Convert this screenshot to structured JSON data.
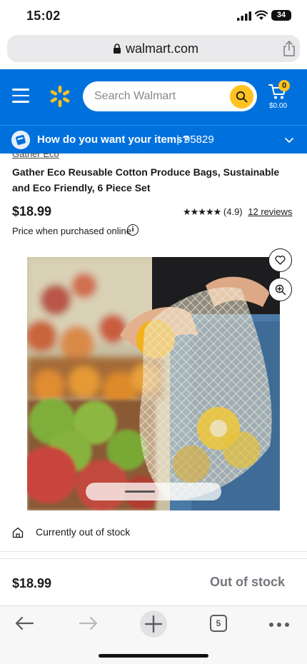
{
  "status_bar": {
    "time": "15:02",
    "battery": "34"
  },
  "browser": {
    "url": "walmart.com",
    "tabs_count": "5"
  },
  "header": {
    "search_placeholder": "Search Walmart",
    "cart_count": "0",
    "cart_total": "$0.00"
  },
  "delivery": {
    "question": "How do you want your items?",
    "separator": "|",
    "zip": "95829"
  },
  "product": {
    "brand": "Gather Eco",
    "title": "Gather Eco Reusable Cotton Produce Bags, Sustainable and Eco Friendly, 6 Piece Set",
    "price": "$18.99",
    "stars": "★★★★★",
    "rating": "(4.9)",
    "reviews": "12 reviews",
    "price_note": "Price when purchased online",
    "info_glyph": "i",
    "stock_status": "Currently out of stock"
  },
  "bottom_bar": {
    "price": "$18.99",
    "status": "Out of stock"
  },
  "colors": {
    "walmart_blue": "#0071dc",
    "spark_yellow": "#ffc220"
  },
  "icons": {
    "menu": "hamburger-icon",
    "logo": "spark-icon",
    "search": "search-icon",
    "cart": "cart-icon",
    "favorite": "heart-icon",
    "zoom": "zoom-in-icon",
    "store": "store-icon",
    "back": "back-arrow-icon",
    "forward": "forward-arrow-icon",
    "new_tab": "plus-icon",
    "more": "more-icon",
    "lock": "lock-icon",
    "share": "share-icon"
  }
}
